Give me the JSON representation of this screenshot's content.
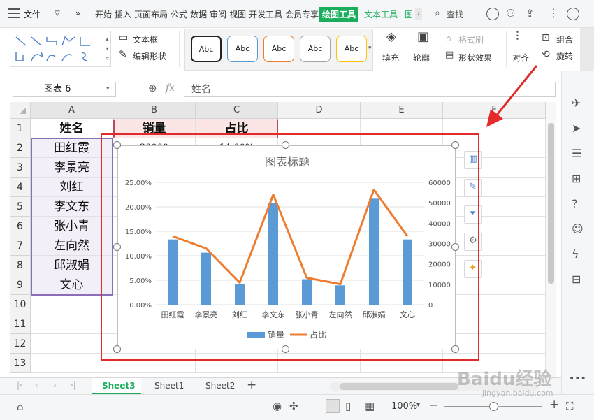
{
  "menubar": {
    "file": "文件",
    "more": "»",
    "items": [
      "开始",
      "插入",
      "页面布局",
      "公式",
      "数据",
      "审阅",
      "视图",
      "开发工具",
      "会员专享"
    ],
    "drawing_tools": "绘图工具",
    "text_tools": "文本工具",
    "chart_tools_partial": "图",
    "search": "查找"
  },
  "ribbon": {
    "textbox": "文本框",
    "edit_shape": "编辑形状",
    "style_label": "Abc",
    "style_colors": [
      "#222222",
      "#5b9bd5",
      "#ed7d31",
      "#a5a5a5",
      "#ffc000"
    ],
    "fill": "填充",
    "outline": "轮廓",
    "format_brush": "格式刷",
    "shape_effects": "形状效果",
    "align": "对齐",
    "group": "组合",
    "rotate": "旋转"
  },
  "formula_bar": {
    "name_box": "图表 6",
    "fx": "fx",
    "formula_value": "姓名"
  },
  "grid": {
    "columns": [
      "A",
      "B",
      "C",
      "D",
      "E",
      "F"
    ],
    "rows": [
      "1",
      "2",
      "3",
      "4",
      "5",
      "6",
      "7",
      "8",
      "9",
      "10",
      "11",
      "12",
      "13"
    ],
    "header": [
      "姓名",
      "销量",
      "占比"
    ],
    "names": [
      "田红霞",
      "李景亮",
      "刘红",
      "李文东",
      "张小青",
      "左向然",
      "邱淑娟",
      "文心"
    ],
    "b2_partial": "30000",
    "c2_partial": "14.00%"
  },
  "chart_data": {
    "type": "bar",
    "title": "图表标题",
    "categories": [
      "田红霞",
      "李景亮",
      "刘红",
      "李文东",
      "张小青",
      "左向然",
      "邱淑娟",
      "文心"
    ],
    "series": [
      {
        "name": "销量",
        "type": "bar",
        "axis": "right",
        "color": "#5b9bd5",
        "values": [
          32000,
          25500,
          10000,
          50000,
          12500,
          9500,
          52000,
          32000
        ]
      },
      {
        "name": "占比",
        "type": "line",
        "axis": "left",
        "color": "#ed7d31",
        "values": [
          0.14,
          0.115,
          0.045,
          0.225,
          0.055,
          0.042,
          0.235,
          0.14
        ]
      }
    ],
    "y_left": {
      "min": 0,
      "max": 0.25,
      "ticks": [
        "0.00%",
        "5.00%",
        "10.00%",
        "15.00%",
        "20.00%",
        "25.00%"
      ]
    },
    "y_right": {
      "min": 0,
      "max": 60000,
      "ticks": [
        "0",
        "10000",
        "20000",
        "30000",
        "40000",
        "50000",
        "60000"
      ]
    },
    "legend": "bottom",
    "grid": true
  },
  "sheets": {
    "tabs": [
      "Sheet3",
      "Sheet1",
      "Sheet2"
    ],
    "active": "Sheet3",
    "add": "+"
  },
  "status": {
    "zoom": "100%",
    "minus": "−",
    "plus": "+"
  },
  "watermark": {
    "brand": "Baidu经验",
    "url": "jingyan.baidu.com"
  },
  "annotation": {
    "highlight_color": "#e32b2b"
  }
}
